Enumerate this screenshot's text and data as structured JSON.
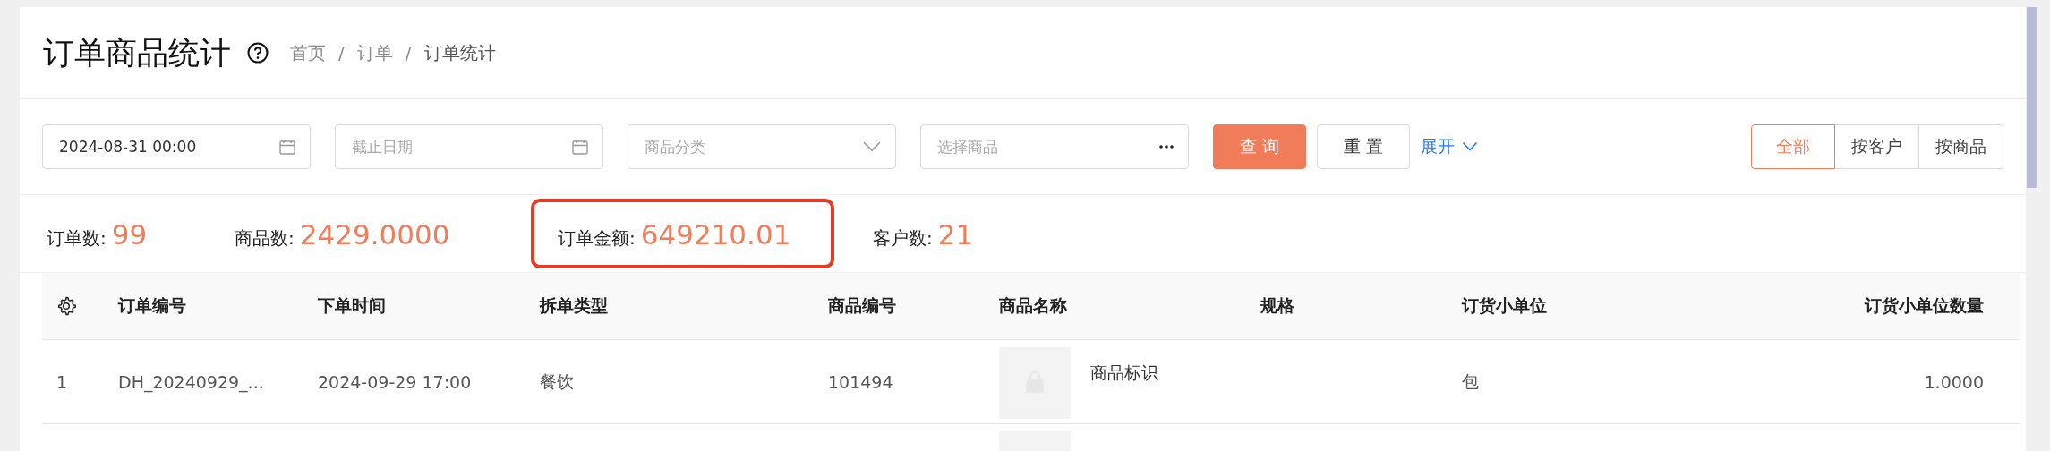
{
  "page": {
    "title": "订单商品统计",
    "breadcrumb": [
      "首页",
      "订单",
      "订单统计"
    ],
    "separator": "/"
  },
  "filters": [
    {
      "kind": "date",
      "value": "2024-08-31 00:00"
    },
    {
      "kind": "date",
      "placeholder": "截止日期"
    },
    {
      "kind": "select",
      "placeholder": "商品分类"
    },
    {
      "kind": "picker",
      "placeholder": "选择商品"
    }
  ],
  "actions": {
    "query": "查 询",
    "reset": "重 置",
    "expand": "展开"
  },
  "view_tabs": [
    {
      "label": "全部",
      "selected": true
    },
    {
      "label": "按客户",
      "selected": false
    },
    {
      "label": "按商品",
      "selected": false
    }
  ],
  "stats": [
    {
      "label": "订单数:",
      "value": "99",
      "highlighted": false
    },
    {
      "label": "商品数:",
      "value": "2429.0000",
      "highlighted": false
    },
    {
      "label": "订单金额:",
      "value": "649210.01",
      "highlighted": true
    },
    {
      "label": "客户数:",
      "value": "21",
      "highlighted": false
    }
  ],
  "table": {
    "columns": [
      "订单编号",
      "下单时间",
      "拆单类型",
      "商品编号",
      "商品名称",
      "规格",
      "订货小单位",
      "订货小单位数量"
    ],
    "rows": [
      {
        "index": "1",
        "order_no": "DH_20240929_...",
        "time": "2024-09-29 17:00",
        "split_type": "餐饮",
        "product_no": "101494",
        "product_name": "商品标识",
        "thumbnail": true,
        "unit": "包",
        "quantity": "1.0000"
      },
      {
        "thumbnail": true
      }
    ]
  }
}
